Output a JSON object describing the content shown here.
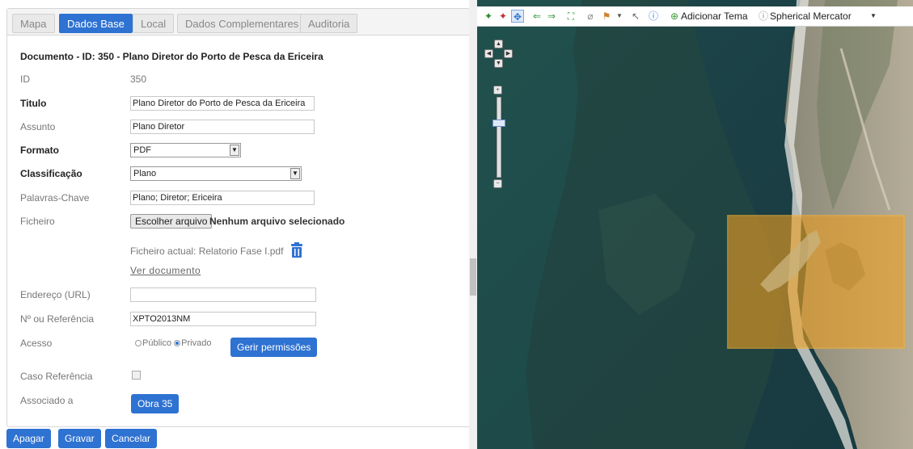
{
  "tabs": [
    {
      "label": "Mapa",
      "active": false
    },
    {
      "label": "Dados Base",
      "active": true
    },
    {
      "label": "Local",
      "active": false
    },
    {
      "label": "Dados Complementares",
      "active": false
    },
    {
      "label": "Auditoria",
      "active": false
    }
  ],
  "document_title": "Documento - ID: 350 - Plano Diretor do Porto de Pesca da Ericeira",
  "form": {
    "id": {
      "label": "ID",
      "value": "350"
    },
    "titulo": {
      "label": "Titulo",
      "value": "Plano Diretor do Porto de Pesca da Ericeira"
    },
    "assunto": {
      "label": "Assunto",
      "value": "Plano Diretor"
    },
    "formato": {
      "label": "Formato",
      "value": "PDF"
    },
    "classificacao": {
      "label": "Classificação",
      "value": "Plano"
    },
    "palavras": {
      "label": "Palavras-Chave",
      "value": "Plano; Diretor; Ericeira"
    },
    "ficheiro": {
      "label": "Ficheiro",
      "button": "Escolher arquivo",
      "status": "Nenhum arquivo selecionado",
      "current": "Ficheiro actual: Relatorio Fase I.pdf",
      "link": "Ver documento"
    },
    "endereco": {
      "label": "Endereço (URL)",
      "value": ""
    },
    "referencia": {
      "label": "Nº ou Referência",
      "value": "XPTO2013NM"
    },
    "acesso": {
      "label": "Acesso",
      "option_public": "Público",
      "option_private": "Privado",
      "selected": "Privado",
      "button": "Gerir permissões"
    },
    "caso": {
      "label": "Caso Referência",
      "checked": false
    },
    "associado": {
      "label": "Associado a",
      "button": "Obra 35"
    }
  },
  "actions": {
    "delete": "Apagar",
    "save": "Gravar",
    "cancel": "Cancelar"
  },
  "map_toolbar": {
    "add_theme": "Adicionar Tema",
    "projection": "Spherical Mercator",
    "icons": [
      "pan-back-icon",
      "pan-forward-icon",
      "pan-icon",
      "previous-extent-icon",
      "next-extent-icon",
      "full-extent-icon",
      "measure-icon",
      "marker-icon",
      "select-icon",
      "info-icon",
      "add-theme-icon",
      "projection-icon"
    ]
  },
  "colors": {
    "primary": "#2e72d2",
    "selection": "#f0a020"
  }
}
